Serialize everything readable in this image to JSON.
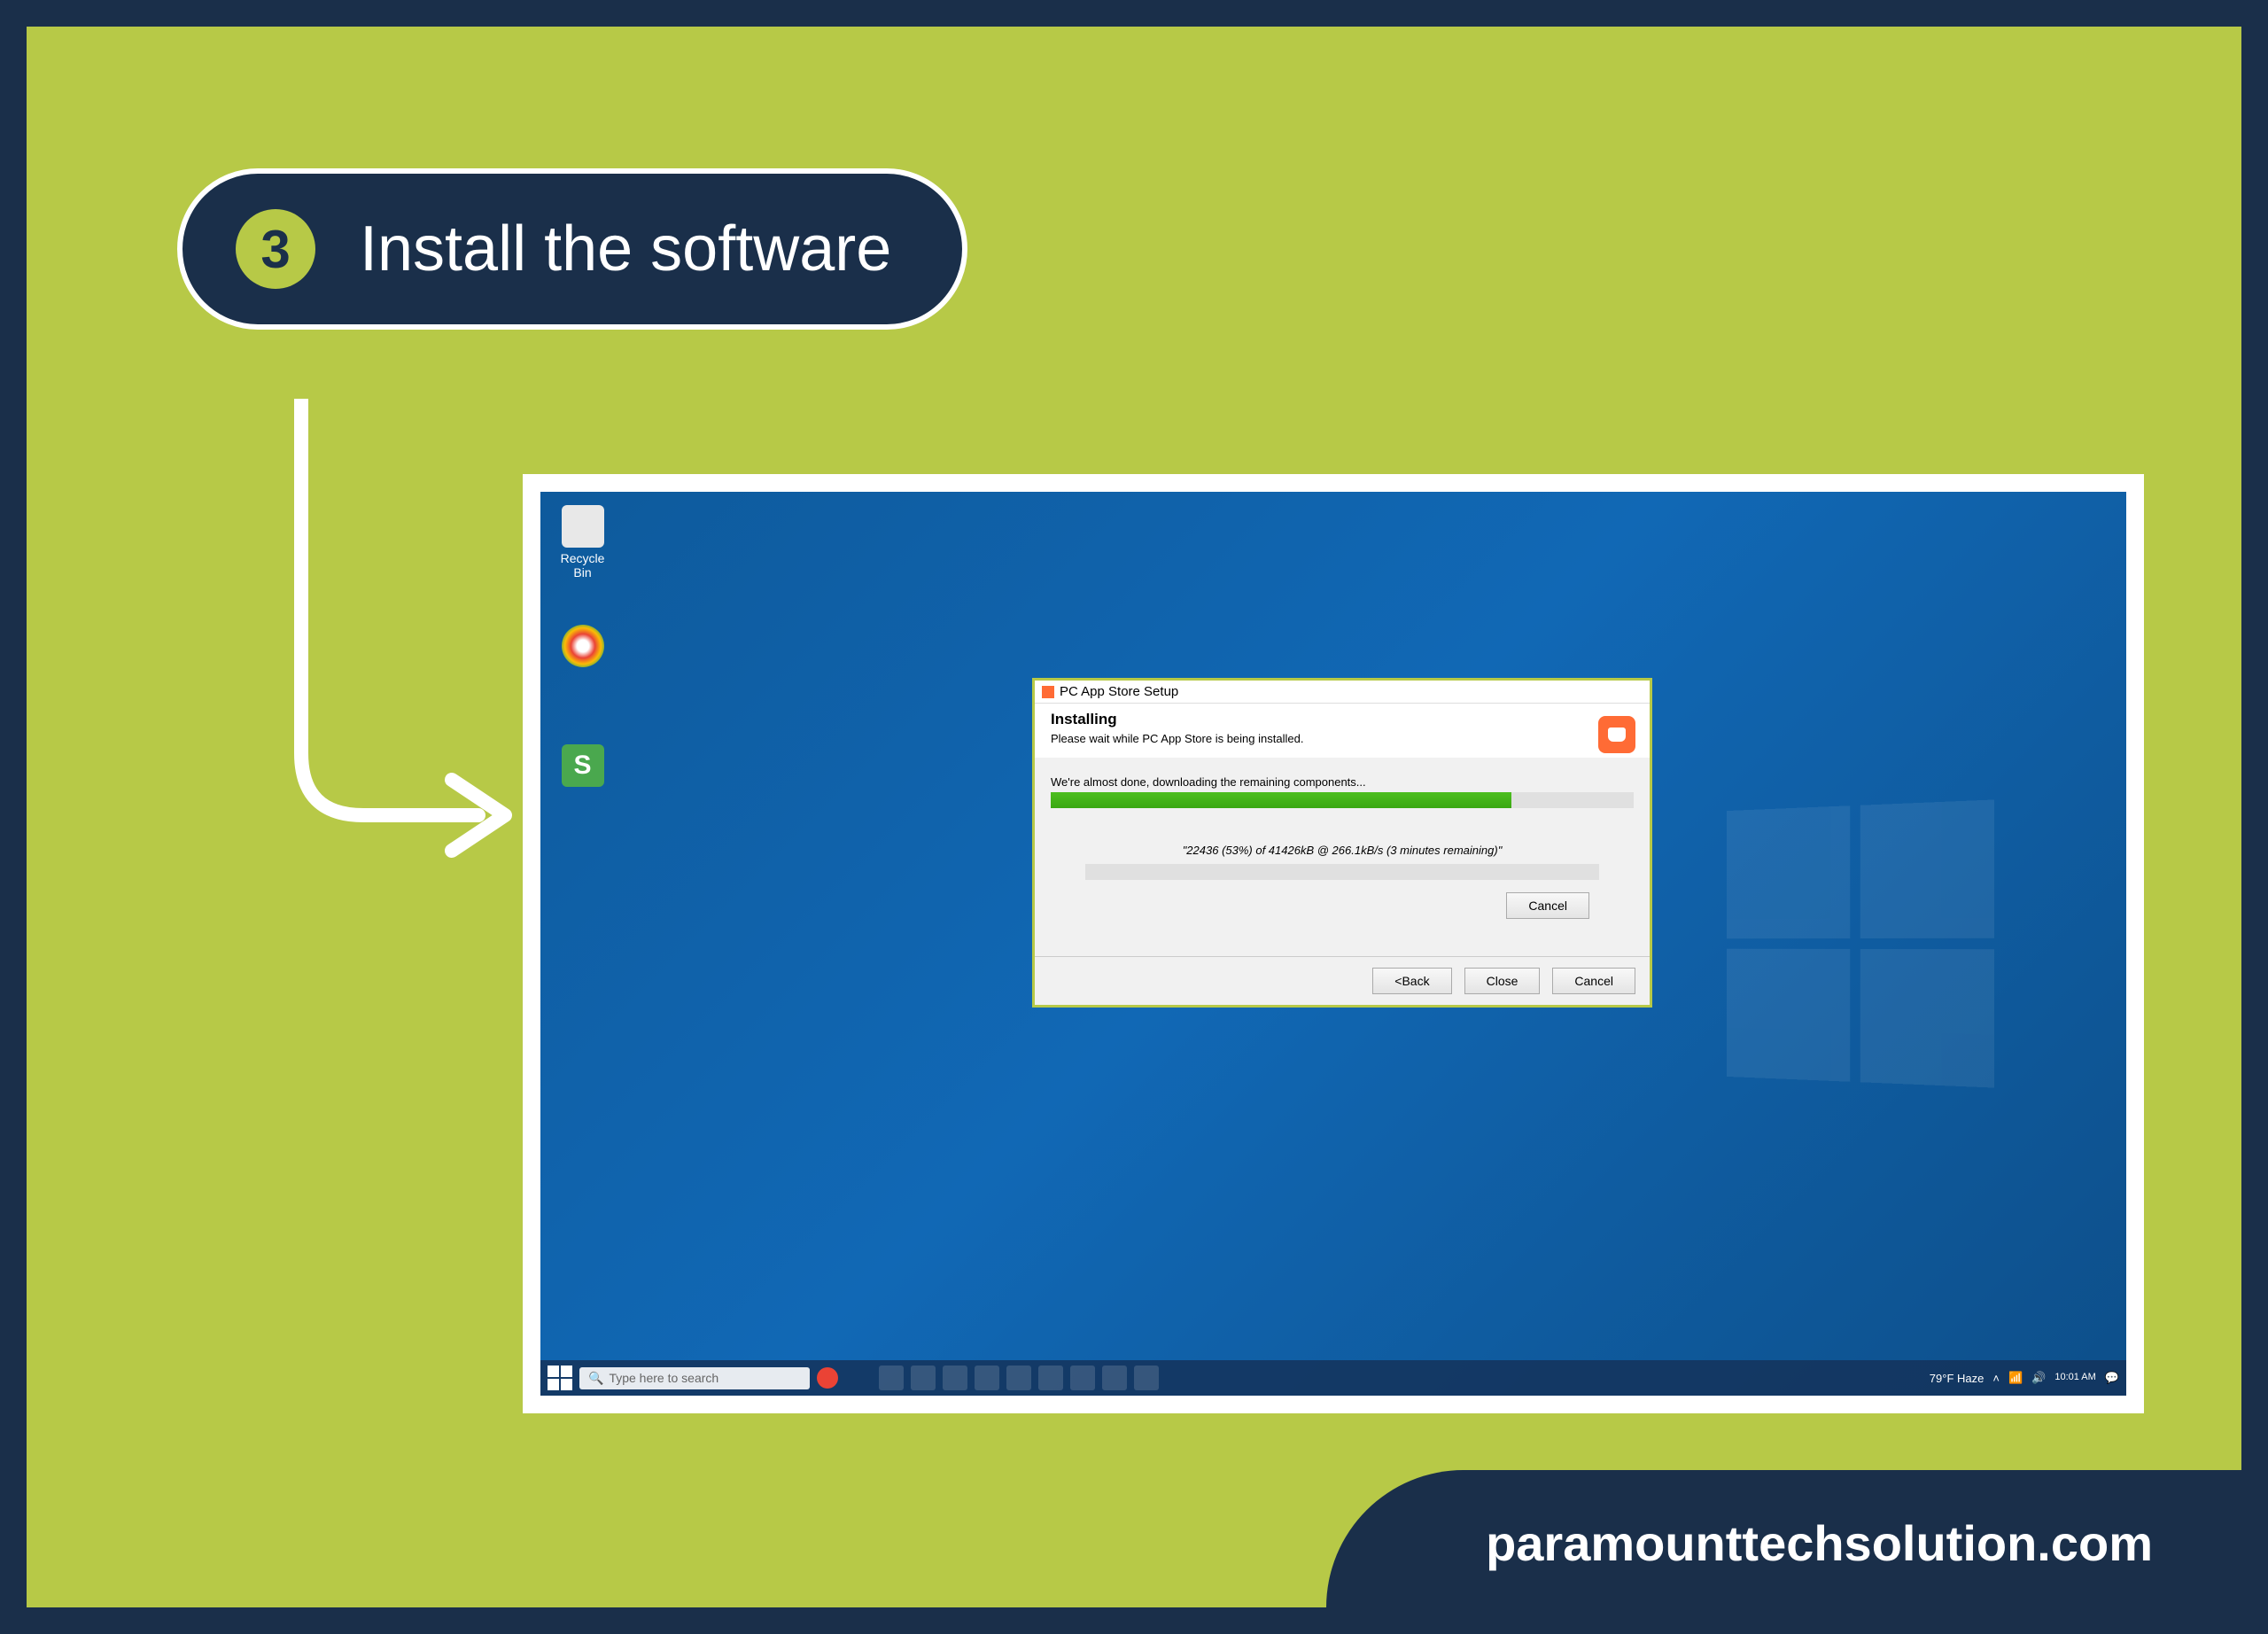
{
  "step": {
    "number": "3",
    "title": "Install the software"
  },
  "desktop": {
    "icons": [
      {
        "label": "Recycle Bin"
      },
      {
        "label": ""
      },
      {
        "label": "S"
      }
    ]
  },
  "installer": {
    "window_title": "PC App Store Setup",
    "header_title": "Installing",
    "header_subtitle": "Please wait while PC App Store is being installed.",
    "status": "We're almost done, downloading the remaining components...",
    "download_info": "\"22436 (53%) of 41426kB @ 266.1kB/s (3 minutes remaining)\"",
    "mid_cancel": "Cancel",
    "buttons": {
      "back": "<Back",
      "close": "Close",
      "cancel": "Cancel"
    }
  },
  "taskbar": {
    "search_placeholder": "Type here to search",
    "weather": "79°F  Haze",
    "time": "10:01 AM",
    "date": ""
  },
  "footer": {
    "website": "paramounttechsolution.com"
  }
}
